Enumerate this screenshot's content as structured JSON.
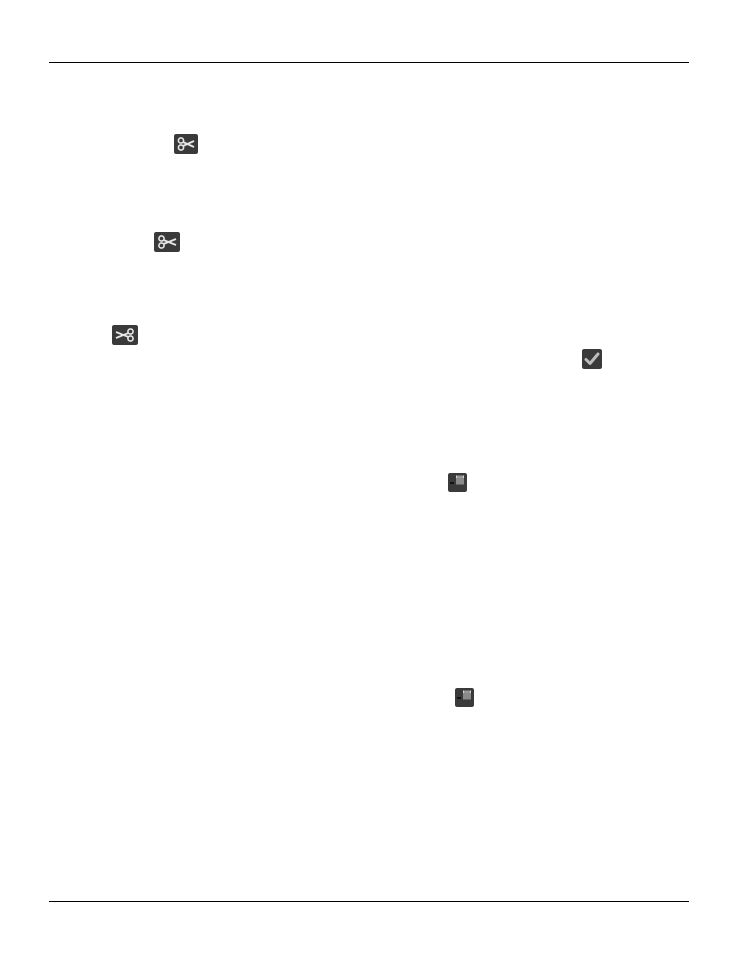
{
  "page": {
    "background": "#ffffff",
    "rule_color": "#000000"
  },
  "icons": {
    "icon_bg": "#3a3a3a",
    "icon_fg": "#e6e6e6",
    "check_color": "#bdbdbd",
    "items": [
      {
        "name": "scissors-icon"
      },
      {
        "name": "scissors-icon"
      },
      {
        "name": "scissors-icon"
      },
      {
        "name": "checkmark-icon"
      },
      {
        "name": "clip-icon"
      },
      {
        "name": "clip-icon"
      }
    ]
  }
}
